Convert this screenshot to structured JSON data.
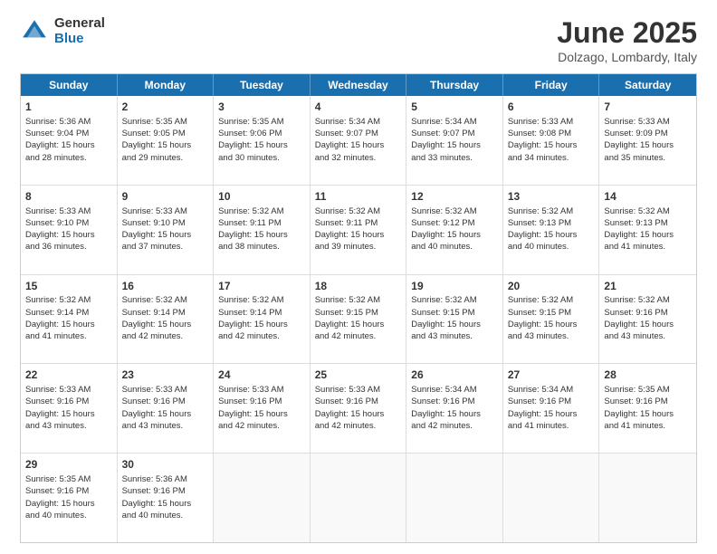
{
  "logo": {
    "general": "General",
    "blue": "Blue"
  },
  "header": {
    "month": "June 2025",
    "location": "Dolzago, Lombardy, Italy"
  },
  "weekdays": [
    "Sunday",
    "Monday",
    "Tuesday",
    "Wednesday",
    "Thursday",
    "Friday",
    "Saturday"
  ],
  "rows": [
    [
      {
        "day": "",
        "info": ""
      },
      {
        "day": "2",
        "info": "Sunrise: 5:35 AM\nSunset: 9:05 PM\nDaylight: 15 hours\nand 29 minutes."
      },
      {
        "day": "3",
        "info": "Sunrise: 5:35 AM\nSunset: 9:06 PM\nDaylight: 15 hours\nand 30 minutes."
      },
      {
        "day": "4",
        "info": "Sunrise: 5:34 AM\nSunset: 9:07 PM\nDaylight: 15 hours\nand 32 minutes."
      },
      {
        "day": "5",
        "info": "Sunrise: 5:34 AM\nSunset: 9:07 PM\nDaylight: 15 hours\nand 33 minutes."
      },
      {
        "day": "6",
        "info": "Sunrise: 5:33 AM\nSunset: 9:08 PM\nDaylight: 15 hours\nand 34 minutes."
      },
      {
        "day": "7",
        "info": "Sunrise: 5:33 AM\nSunset: 9:09 PM\nDaylight: 15 hours\nand 35 minutes."
      }
    ],
    [
      {
        "day": "1",
        "info": "Sunrise: 5:36 AM\nSunset: 9:04 PM\nDaylight: 15 hours\nand 28 minutes."
      },
      {
        "day": "",
        "info": ""
      },
      {
        "day": "",
        "info": ""
      },
      {
        "day": "",
        "info": ""
      },
      {
        "day": "",
        "info": ""
      },
      {
        "day": "",
        "info": ""
      },
      {
        "day": "",
        "info": ""
      }
    ],
    [
      {
        "day": "8",
        "info": "Sunrise: 5:33 AM\nSunset: 9:10 PM\nDaylight: 15 hours\nand 36 minutes."
      },
      {
        "day": "9",
        "info": "Sunrise: 5:33 AM\nSunset: 9:10 PM\nDaylight: 15 hours\nand 37 minutes."
      },
      {
        "day": "10",
        "info": "Sunrise: 5:32 AM\nSunset: 9:11 PM\nDaylight: 15 hours\nand 38 minutes."
      },
      {
        "day": "11",
        "info": "Sunrise: 5:32 AM\nSunset: 9:11 PM\nDaylight: 15 hours\nand 39 minutes."
      },
      {
        "day": "12",
        "info": "Sunrise: 5:32 AM\nSunset: 9:12 PM\nDaylight: 15 hours\nand 40 minutes."
      },
      {
        "day": "13",
        "info": "Sunrise: 5:32 AM\nSunset: 9:13 PM\nDaylight: 15 hours\nand 40 minutes."
      },
      {
        "day": "14",
        "info": "Sunrise: 5:32 AM\nSunset: 9:13 PM\nDaylight: 15 hours\nand 41 minutes."
      }
    ],
    [
      {
        "day": "15",
        "info": "Sunrise: 5:32 AM\nSunset: 9:14 PM\nDaylight: 15 hours\nand 41 minutes."
      },
      {
        "day": "16",
        "info": "Sunrise: 5:32 AM\nSunset: 9:14 PM\nDaylight: 15 hours\nand 42 minutes."
      },
      {
        "day": "17",
        "info": "Sunrise: 5:32 AM\nSunset: 9:14 PM\nDaylight: 15 hours\nand 42 minutes."
      },
      {
        "day": "18",
        "info": "Sunrise: 5:32 AM\nSunset: 9:15 PM\nDaylight: 15 hours\nand 42 minutes."
      },
      {
        "day": "19",
        "info": "Sunrise: 5:32 AM\nSunset: 9:15 PM\nDaylight: 15 hours\nand 43 minutes."
      },
      {
        "day": "20",
        "info": "Sunrise: 5:32 AM\nSunset: 9:15 PM\nDaylight: 15 hours\nand 43 minutes."
      },
      {
        "day": "21",
        "info": "Sunrise: 5:32 AM\nSunset: 9:16 PM\nDaylight: 15 hours\nand 43 minutes."
      }
    ],
    [
      {
        "day": "22",
        "info": "Sunrise: 5:33 AM\nSunset: 9:16 PM\nDaylight: 15 hours\nand 43 minutes."
      },
      {
        "day": "23",
        "info": "Sunrise: 5:33 AM\nSunset: 9:16 PM\nDaylight: 15 hours\nand 43 minutes."
      },
      {
        "day": "24",
        "info": "Sunrise: 5:33 AM\nSunset: 9:16 PM\nDaylight: 15 hours\nand 42 minutes."
      },
      {
        "day": "25",
        "info": "Sunrise: 5:33 AM\nSunset: 9:16 PM\nDaylight: 15 hours\nand 42 minutes."
      },
      {
        "day": "26",
        "info": "Sunrise: 5:34 AM\nSunset: 9:16 PM\nDaylight: 15 hours\nand 42 minutes."
      },
      {
        "day": "27",
        "info": "Sunrise: 5:34 AM\nSunset: 9:16 PM\nDaylight: 15 hours\nand 41 minutes."
      },
      {
        "day": "28",
        "info": "Sunrise: 5:35 AM\nSunset: 9:16 PM\nDaylight: 15 hours\nand 41 minutes."
      }
    ],
    [
      {
        "day": "29",
        "info": "Sunrise: 5:35 AM\nSunset: 9:16 PM\nDaylight: 15 hours\nand 40 minutes."
      },
      {
        "day": "30",
        "info": "Sunrise: 5:36 AM\nSunset: 9:16 PM\nDaylight: 15 hours\nand 40 minutes."
      },
      {
        "day": "",
        "info": ""
      },
      {
        "day": "",
        "info": ""
      },
      {
        "day": "",
        "info": ""
      },
      {
        "day": "",
        "info": ""
      },
      {
        "day": "",
        "info": ""
      }
    ]
  ]
}
